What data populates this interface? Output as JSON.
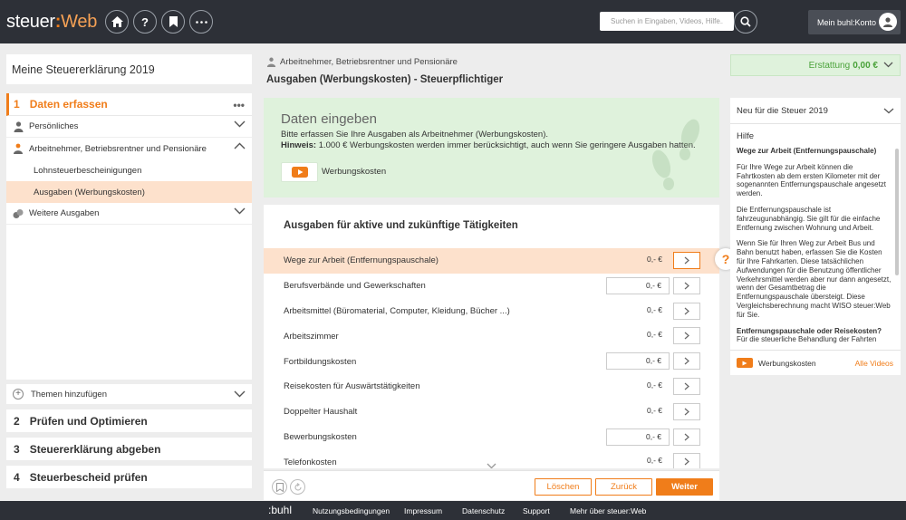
{
  "header": {
    "logo_main": "steuer",
    "logo_colon": ":",
    "logo_sub": "Web",
    "icons": [
      "home-icon",
      "help-icon",
      "bookmark-icon",
      "more-icon"
    ],
    "search_placeholder": "Suchen in Eingaben, Videos, Hilfe...",
    "account_label": "Mein buhl:Konto"
  },
  "sidebar": {
    "title": "Meine Steuererklärung 2019",
    "step1": {
      "num": "1",
      "label": "Daten erfassen"
    },
    "items": [
      {
        "label": "Persönliches",
        "icon": "person-icon"
      },
      {
        "label": "Arbeitnehmer, Betriebsrentner und Pensionäre",
        "icon": "worker-icon"
      }
    ],
    "subitems": [
      {
        "label": "Lohnsteuerbescheinigungen"
      },
      {
        "label": "Ausgaben (Werbungskosten)"
      }
    ],
    "more_label": "Weitere Ausgaben",
    "add_themes": "Themen hinzufügen",
    "steps": [
      {
        "num": "2",
        "label": "Prüfen und Optimieren"
      },
      {
        "num": "3",
        "label": "Steuererklärung abgeben"
      },
      {
        "num": "4",
        "label": "Steuerbescheid prüfen"
      }
    ]
  },
  "main": {
    "breadcrumb": "Arbeitnehmer, Betriebsrentner und Pensionäre",
    "title": "Ausgaben (Werbungskosten) - Steuerpflichtiger",
    "intro": {
      "heading": "Daten eingeben",
      "text": "Bitte erfassen Sie Ihre Ausgaben als Arbeitnehmer (Werbungskosten).",
      "hint_label": "Hinweis:",
      "hint_text": " 1.000 € Werbungskosten werden immer berücksichtigt, auch wenn Sie geringere Ausgaben hatten.",
      "video_label": "Werbungskosten"
    },
    "section_title": "Ausgaben für aktive und zukünftige Tätigkeiten",
    "rows": [
      {
        "label": "Wege zur Arbeit (Entfernungspauschale)",
        "amount": "0,-  €",
        "boxed": false,
        "active": true
      },
      {
        "label": "Berufsverbände und Gewerkschaften",
        "amount": "0,-  €",
        "boxed": true,
        "active": false
      },
      {
        "label": "Arbeitsmittel (Büromaterial, Computer, Kleidung, Bücher ...)",
        "amount": "0,-  €",
        "boxed": false,
        "active": false
      },
      {
        "label": "Arbeitszimmer",
        "amount": "0,-  €",
        "boxed": false,
        "active": false
      },
      {
        "label": "Fortbildungskosten",
        "amount": "0,-  €",
        "boxed": true,
        "active": false
      },
      {
        "label": "Reisekosten für Auswärtstätigkeiten",
        "amount": "0,-  €",
        "boxed": false,
        "active": false
      },
      {
        "label": "Doppelter Haushalt",
        "amount": "0,-  €",
        "boxed": false,
        "active": false
      },
      {
        "label": "Bewerbungskosten",
        "amount": "0,-  €",
        "boxed": true,
        "active": false
      },
      {
        "label": "Telefonkosten",
        "amount": "0,-  €",
        "boxed": false,
        "active": false
      }
    ],
    "buttons": {
      "delete": "Löschen",
      "back": "Zurück",
      "next": "Weiter"
    }
  },
  "right": {
    "refund_label": "Erstattung",
    "refund_value": "0,00 €",
    "news_title": "Neu für die Steuer 2019",
    "help_title": "Hilfe",
    "help_paragraphs": [
      "Wege zur Arbeit (Entfernungspauschale)",
      "Für Ihre Wege zur Arbeit können die Fahrtkosten ab dem ersten Kilometer mit der sogenannten Entfernungspauschale angesetzt werden.",
      "Die Entfernungspauschale ist fahrzeugunabhängig. Sie gilt für die einfache Entfernung zwischen Wohnung und Arbeit.",
      "Wenn Sie für Ihren Weg zur Arbeit Bus und Bahn benutzt haben, erfassen Sie die Kosten für Ihre Fahrkarten. Diese tatsächlichen Aufwendungen für die Benutzung öffentlicher Verkehrsmittel werden aber nur dann angesetzt, wenn der Gesamtbetrag die Entfernungspauschale übersteigt. Diese Vergleichsberechnung macht WISO steuer:Web für Sie.",
      "Entfernungspauschale oder Reisekosten?",
      "Für die steuerliche Behandlung der Fahrten spielt diese Entscheidung eine große Rolle."
    ],
    "video_label": "Werbungskosten",
    "all_videos": "Alle Videos"
  },
  "footer": {
    "logo": ":buhl",
    "links": [
      "Nutzungsbedingungen",
      "Impressum",
      "Datenschutz",
      "Support",
      "Mehr über steuer:Web"
    ]
  },
  "colors": {
    "accent": "#f07d1a",
    "topbar": "#2d3037",
    "green_bg": "#dff2dc",
    "active_row": "#fde1cc"
  }
}
